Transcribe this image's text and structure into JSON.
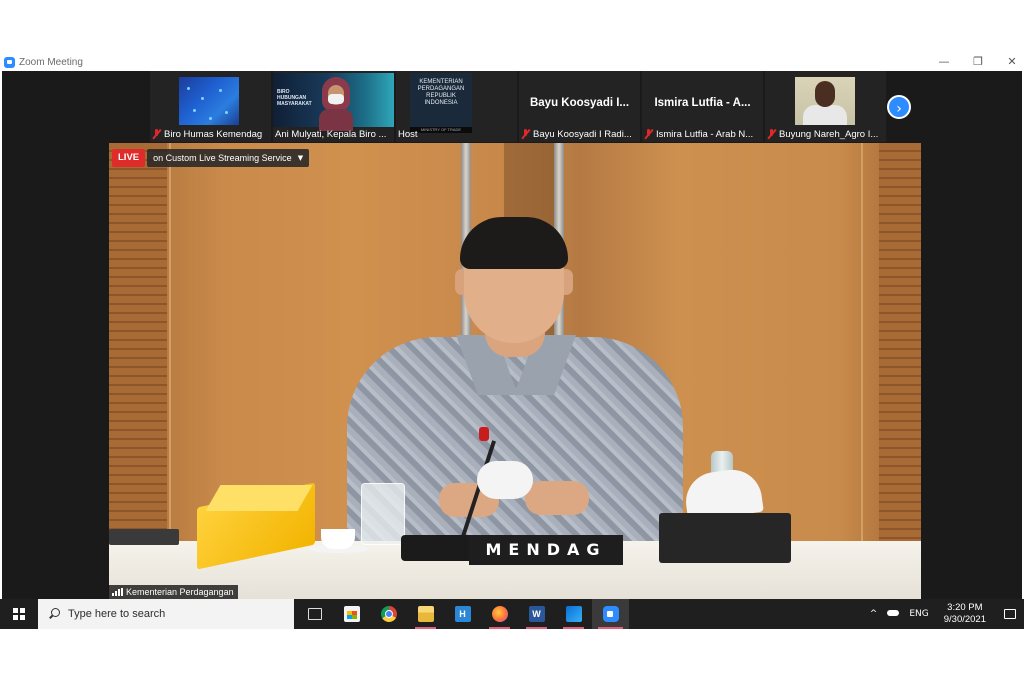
{
  "window": {
    "title": "Zoom Meeting",
    "controls": [
      "—",
      "❐",
      "✕"
    ]
  },
  "participants": [
    {
      "name": "Biro Humas Kemendag",
      "muted": true,
      "video": "image"
    },
    {
      "name": "Ani Mulyati, Kepala Biro ...",
      "muted": false,
      "video": "image",
      "slide_text": "BIRO HUBUNGAN MASYARAKAT"
    },
    {
      "name": "Host",
      "muted": false,
      "video": "image",
      "slide_text": "KEMENTERIAN PERDAGANGAN REPUBLIK INDONESIA",
      "footer_text": "MINISTRY OF TRADE"
    },
    {
      "name": "Bayu Koosyadi I Radi...",
      "muted": true,
      "display_name": "Bayu Koosyadi I..."
    },
    {
      "name": "Ismira Lutfia - Arab N...",
      "muted": true,
      "display_name": "Ismira Lutfia - A..."
    },
    {
      "name": "Buyung Nareh_Agro I...",
      "muted": true,
      "video": "image"
    }
  ],
  "next_page_icon": "chevron-right-icon",
  "live": {
    "badge": "LIVE",
    "service": "on Custom Live Streaming Service",
    "caret": "▼"
  },
  "main_video": {
    "nameplate": "MENDAG",
    "speaker_label": "Kementerian Perdagangan"
  },
  "taskbar": {
    "search_placeholder": "Type here to search",
    "apps": [
      "task-view",
      "microsoft-store",
      "chrome",
      "file-explorer",
      "app-h",
      "firefox",
      "word",
      "photos",
      "zoom"
    ],
    "app_h_letter": "H",
    "word_letter": "W",
    "tray_chevron": "^",
    "language": "ENG",
    "time": "3:20 PM",
    "date": "9/30/2021"
  },
  "colors": {
    "zoom_blue": "#2d8cff",
    "live_red": "#e02b2b",
    "mute_red": "#e02828"
  }
}
